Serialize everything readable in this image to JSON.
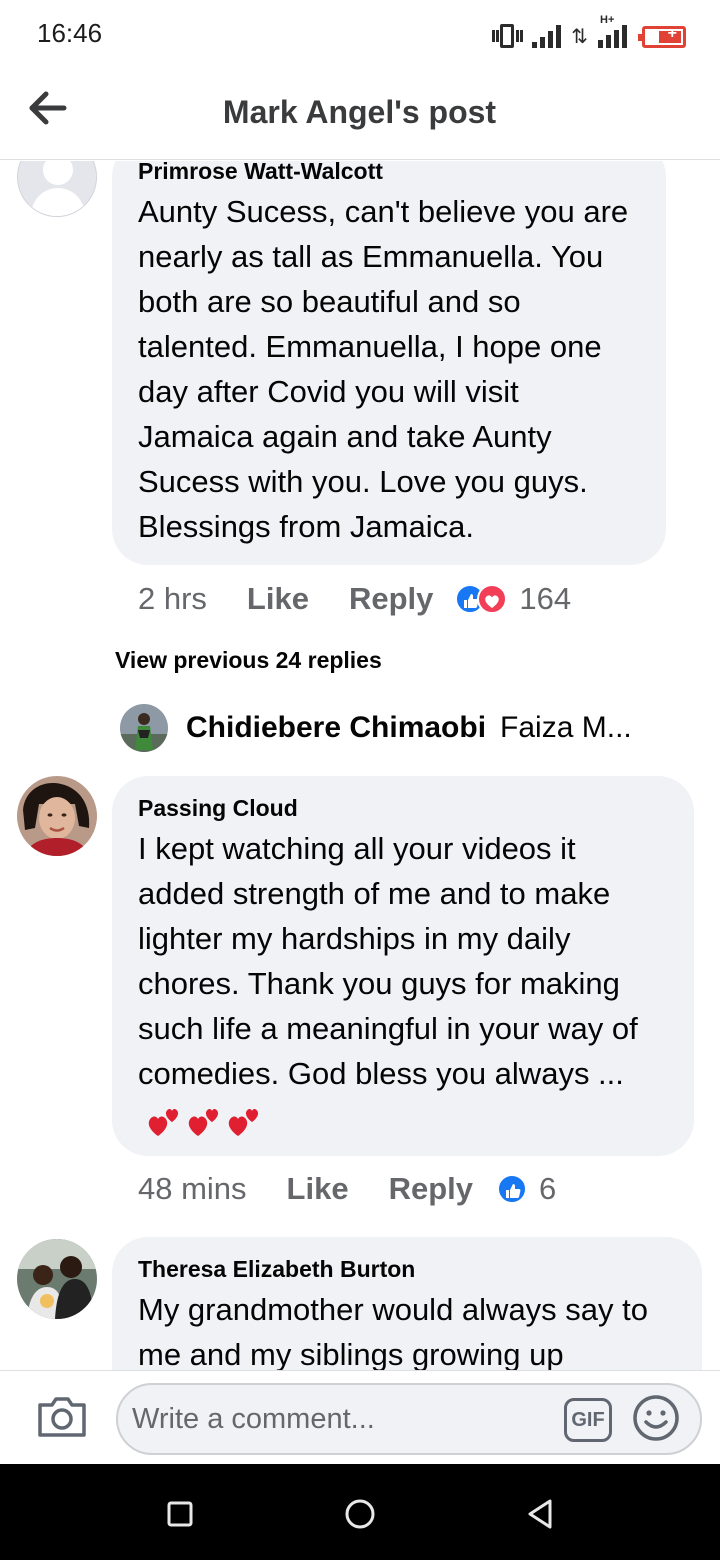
{
  "status_bar": {
    "time": "16:46",
    "network_label": "H+"
  },
  "header": {
    "title": "Mark Angel's post"
  },
  "comments": [
    {
      "author": "Primrose Watt-Walcott",
      "text": "Aunty Sucess, can't  believe  you are nearly  as tall as Emmanuella. You both  are so beautiful and so talented. Emmanuella, I hope one day after Covid you will visit Jamaica again and take Aunty Sucess with you. Love you guys. Blessings from Jamaica.",
      "time": "2 hrs",
      "like_label": "Like",
      "reply_label": "Reply",
      "reaction_count": "164"
    },
    {
      "author": "Passing Cloud",
      "text": "I kept watching  all your videos it added strength of me and to make lighter my hardships in my daily chores. Thank you guys for making such life a meaningful in your way of comedies. God bless you always ...",
      "time": "48 mins",
      "like_label": "Like",
      "reply_label": "Reply",
      "reaction_count": "6"
    },
    {
      "author": "Theresa Elizabeth Burton",
      "text": "My grandmother would always say to me and my siblings growing up"
    }
  ],
  "view_previous": "View previous 24 replies",
  "reply_preview": {
    "name": "Chidiebere Chimaobi",
    "text": "Faiza M..."
  },
  "composer": {
    "placeholder": "Write a comment...",
    "gif_label": "GIF"
  },
  "colors": {
    "like_blue": "#1877f2",
    "love_red": "#f33e58",
    "bubble_bg": "#f0f2f5"
  }
}
